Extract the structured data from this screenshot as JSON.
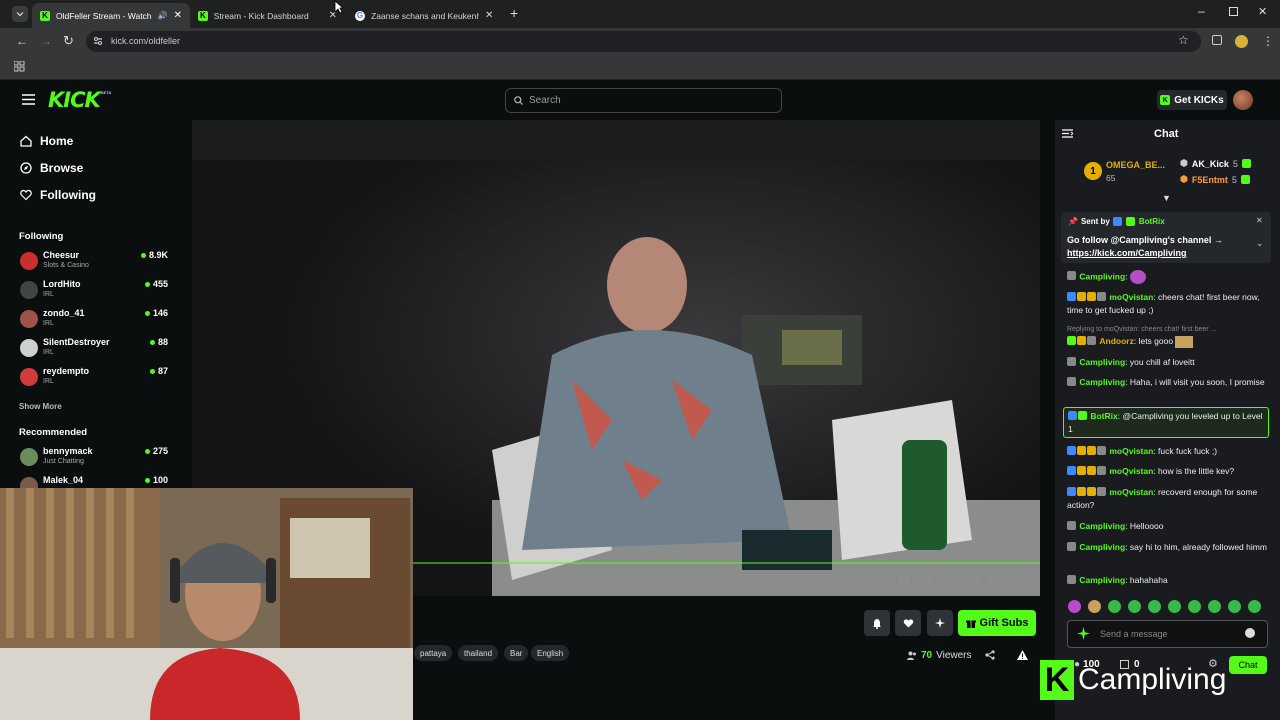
{
  "browser": {
    "tabs": [
      {
        "title": "OldFeller Stream - Watch Li...",
        "active": true
      },
      {
        "title": "Stream - Kick Dashboard",
        "active": false
      },
      {
        "title": "Zaanse schans and Keukenhof",
        "active": false
      }
    ],
    "url": "kick.com/oldfeller"
  },
  "site": {
    "logo": "KICK",
    "logo_badge": "BETA",
    "search_placeholder": "Search",
    "get_kicks": "Get KICKs"
  },
  "sidebar": {
    "nav": [
      "Home",
      "Browse",
      "Following"
    ],
    "following_title": "Following",
    "following": [
      {
        "name": "Cheesur",
        "category": "Slots & Casino",
        "viewers": "8.9K"
      },
      {
        "name": "LordHito",
        "category": "IRL",
        "viewers": "455"
      },
      {
        "name": "zondo_41",
        "category": "IRL",
        "viewers": "146"
      },
      {
        "name": "SilentDestroyer",
        "category": "IRL",
        "viewers": "88"
      },
      {
        "name": "reydempto",
        "category": "IRL",
        "viewers": "87"
      }
    ],
    "show_more": "Show More",
    "recommended_title": "Recommended",
    "recommended": [
      {
        "name": "bennymack",
        "category": "Just Chatting",
        "viewers": "275"
      },
      {
        "name": "Malek_04",
        "category": "",
        "viewers": "100"
      }
    ]
  },
  "stream": {
    "gift_subs": "Gift Subs",
    "tags": [
      "pattaya",
      "thailand",
      "Bar",
      "English"
    ],
    "viewers_count": "70",
    "viewers_label": "Viewers"
  },
  "chat": {
    "title": "Chat",
    "leaderboard": {
      "rank": "1",
      "top_name": "OMEGA_BE...",
      "top_count": "65",
      "others": [
        {
          "name": "AK_Kick",
          "count": "5"
        },
        {
          "name": "F5Entmt",
          "count": "5"
        }
      ]
    },
    "pinned": {
      "sent_by_label": "Sent by",
      "sender": "BotRix",
      "text": "Go follow @Campliving's channel →",
      "link": "https://kick.com/Campliving"
    },
    "messages": [
      {
        "user": "Campliving",
        "text": ""
      },
      {
        "user": "moQvistan",
        "text": "cheers chat! first beer now, time to get fucked up ;)"
      },
      {
        "reply": "Replying to moQvistan: cheers chat! first beer ...",
        "user": "Andoorz",
        "text": "lets gooo"
      },
      {
        "user": "Campliving",
        "text": "you chill af loveitt"
      },
      {
        "user": "Campliving",
        "text": "Haha, i will visit you soon, I promise"
      },
      {
        "user": "BotRix",
        "text": "@Campliving you leveled up to Level 1",
        "highlight": true
      },
      {
        "user": "moQvistan",
        "text": "fuck fuck fuck ;)"
      },
      {
        "user": "moQvistan",
        "text": "how is the little kev?"
      },
      {
        "user": "moQvistan",
        "text": "recoverd enough for some action?"
      },
      {
        "user": "Campliving",
        "text": "Helloooo"
      },
      {
        "user": "Campliving",
        "text": "say hi to him, already followed himm"
      },
      {
        "user": "Campliving",
        "text": "hahahaha"
      }
    ],
    "input_placeholder": "Send a message",
    "points": "100",
    "store_count": "0",
    "send_label": "Chat"
  },
  "overlay": {
    "brand": "Campliving"
  },
  "colors": {
    "kick_green": "#53fc18",
    "background": "#0b0e0f",
    "chat_bg": "#191b1f"
  }
}
